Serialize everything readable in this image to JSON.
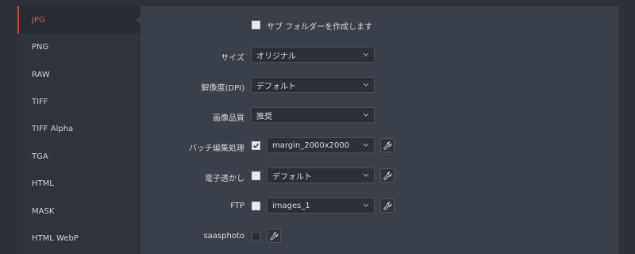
{
  "sidebar": {
    "items": [
      {
        "label": "JPG",
        "active": true
      },
      {
        "label": "PNG",
        "active": false
      },
      {
        "label": "RAW",
        "active": false
      },
      {
        "label": "TIFF",
        "active": false
      },
      {
        "label": "TIFF Alpha",
        "active": false
      },
      {
        "label": "TGA",
        "active": false
      },
      {
        "label": "HTML",
        "active": false
      },
      {
        "label": "MASK",
        "active": false
      },
      {
        "label": "HTML WebP",
        "active": false
      }
    ]
  },
  "settings": {
    "subfolder": {
      "label": "サブ フォルダーを作成します",
      "checked": false
    },
    "size": {
      "label": "サイズ",
      "value": "オリジナル"
    },
    "dpi": {
      "label": "解像度(DPI)",
      "value": "デフォルト"
    },
    "quality": {
      "label": "画像品質",
      "value": "推奨"
    },
    "batch": {
      "label": "バッチ編集処理",
      "checked": true,
      "value": "margin_2000x2000"
    },
    "watermark": {
      "label": "電子透かし",
      "checked": false,
      "value": "デフォルト"
    },
    "ftp": {
      "label": "FTP",
      "checked": false,
      "value": "images_1"
    },
    "saasphoto": {
      "label": "saasphoto",
      "checked": false
    }
  },
  "colors": {
    "accent": "#d9473c",
    "background": "#2c3139",
    "panel": "#3a4049",
    "sidebar": "#2f343c"
  }
}
